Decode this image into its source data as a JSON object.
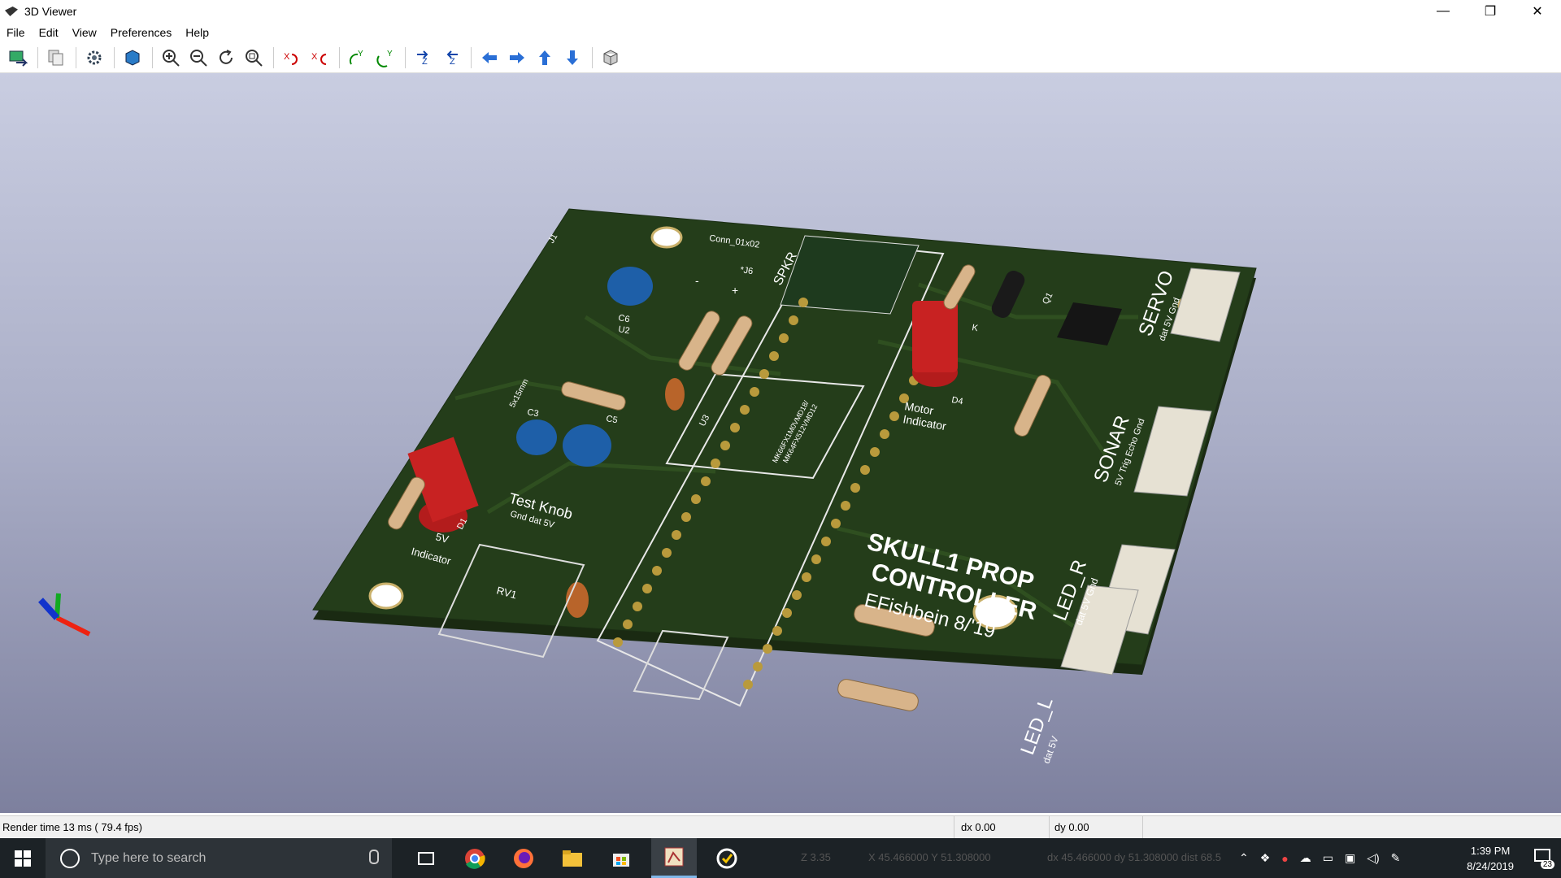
{
  "window": {
    "title": "3D Viewer",
    "controls": {
      "minimize": "—",
      "maximize": "❐",
      "close": "✕"
    }
  },
  "menu": [
    "File",
    "Edit",
    "View",
    "Preferences",
    "Help"
  ],
  "toolbar": {
    "icons": [
      "export-icon",
      "copy-icon",
      "settings-icon",
      "render-mode-icon",
      "zoom-in-icon",
      "zoom-out-icon",
      "redraw-icon",
      "zoom-fit-icon",
      "rotate-x-cw-icon",
      "rotate-x-ccw-icon",
      "rotate-y-cw-icon",
      "rotate-y-ccw-icon",
      "rotate-z-cw-icon",
      "rotate-z-ccw-icon",
      "move-left-icon",
      "move-right-icon",
      "move-up-icon",
      "move-down-icon",
      "orthographic-icon"
    ]
  },
  "board": {
    "silk": {
      "j1": "J1",
      "conn": "Conn_01x02",
      "j6": "*J6",
      "spkr": "SPKR",
      "c6": "C6",
      "u2": "U2",
      "size": "5x15mm",
      "u3": "U3",
      "chip": "MK66FX1M0VMD18/",
      "chip2": "MK64FX512VMD12",
      "d4": "D4",
      "k": "K",
      "motor1": "Motor",
      "motor2": "Indicator",
      "q1": "Q1",
      "servo": "SERVO",
      "servo_pins": "dat 5V Gnd",
      "sonar": "SONAR",
      "sonar_pins": "5V Trig Echo Gnd",
      "title1": "SKULL1 PROP",
      "title2": "CONTROLLER",
      "author": "EFishbein 8/'19",
      "ledr": "LED_R",
      "ledr_pins": "dat 5V Gnd",
      "ledl": "LED_L",
      "ledl_pins": "dat 5V",
      "c5": "C5",
      "c3": "C3",
      "d1": "D1",
      "ind1": "5V",
      "ind2": "Indicator",
      "knob": "Test Knob",
      "knob_pins": "Gnd  dat  5V",
      "rv1": "RV1",
      "minus": "-",
      "plus": "+"
    }
  },
  "status": {
    "render": "Render time 13 ms ( 79.4 fps)",
    "dx": "dx 0.00",
    "dy": "dy 0.00"
  },
  "taskbar": {
    "search_placeholder": "Type here to search",
    "ghost": {
      "z": "Z 3.35",
      "xy": "X 45.466000  Y 51.308000",
      "dxy": "dx 45.466000  dy 51.308000  dist 68.5"
    },
    "apps": [
      "task-view-icon",
      "chrome-icon",
      "firefox-icon",
      "file-explorer-icon",
      "store-icon",
      "kicad-pcbnew-icon",
      "norton-icon"
    ],
    "time": "1:39 PM",
    "date": "8/24/2019",
    "notification_count": "23"
  }
}
